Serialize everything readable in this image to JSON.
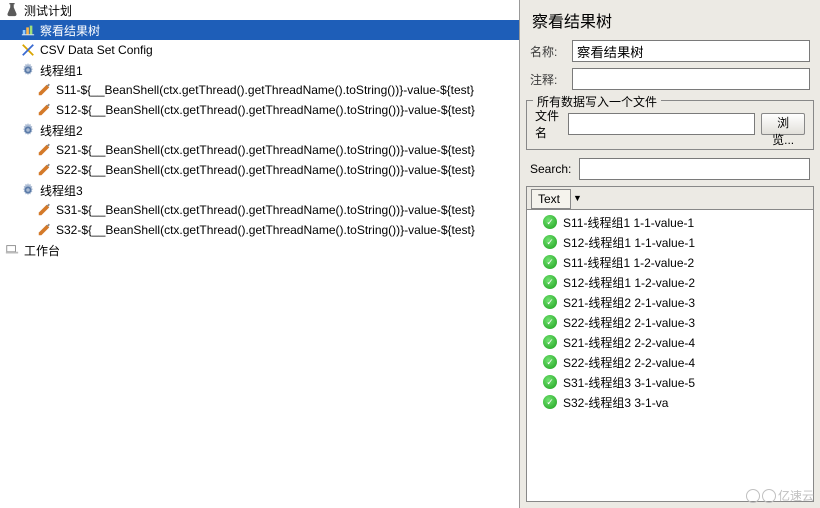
{
  "tree": {
    "root": "测试计划",
    "resultsTree": "察看结果树",
    "csv": "CSV Data Set Config",
    "groups": [
      {
        "label": "线程组1",
        "children": [
          "S11-${__BeanShell(ctx.getThread().getThreadName().toString())}-value-${test}",
          "S12-${__BeanShell(ctx.getThread().getThreadName().toString())}-value-${test}"
        ]
      },
      {
        "label": "线程组2",
        "children": [
          "S21-${__BeanShell(ctx.getThread().getThreadName().toString())}-value-${test}",
          "S22-${__BeanShell(ctx.getThread().getThreadName().toString())}-value-${test}"
        ]
      },
      {
        "label": "线程组3",
        "children": [
          "S31-${__BeanShell(ctx.getThread().getThreadName().toString())}-value-${test}",
          "S32-${__BeanShell(ctx.getThread().getThreadName().toString())}-value-${test}"
        ]
      }
    ],
    "workbench": "工作台"
  },
  "right": {
    "title": "察看结果树",
    "nameLabel": "名称:",
    "nameValue": "察看结果树",
    "commentLabel": "注释:",
    "commentValue": "",
    "fileLegend": "所有数据写入一个文件",
    "fileLabel": "文件名",
    "fileValue": "",
    "browseLabel": "浏览...",
    "searchLabel": "Search:",
    "searchValue": "",
    "textTab": "Text"
  },
  "results": [
    "S11-线程组1 1-1-value-1",
    "S12-线程组1 1-1-value-1",
    "S11-线程组1 1-2-value-2",
    "S12-线程组1 1-2-value-2",
    "S21-线程组2 2-1-value-3",
    "S22-线程组2 2-1-value-3",
    "S21-线程组2 2-2-value-4",
    "S22-线程组2 2-2-value-4",
    "S31-线程组3 3-1-value-5",
    "S32-线程组3 3-1-va"
  ],
  "watermark": "亿速云"
}
